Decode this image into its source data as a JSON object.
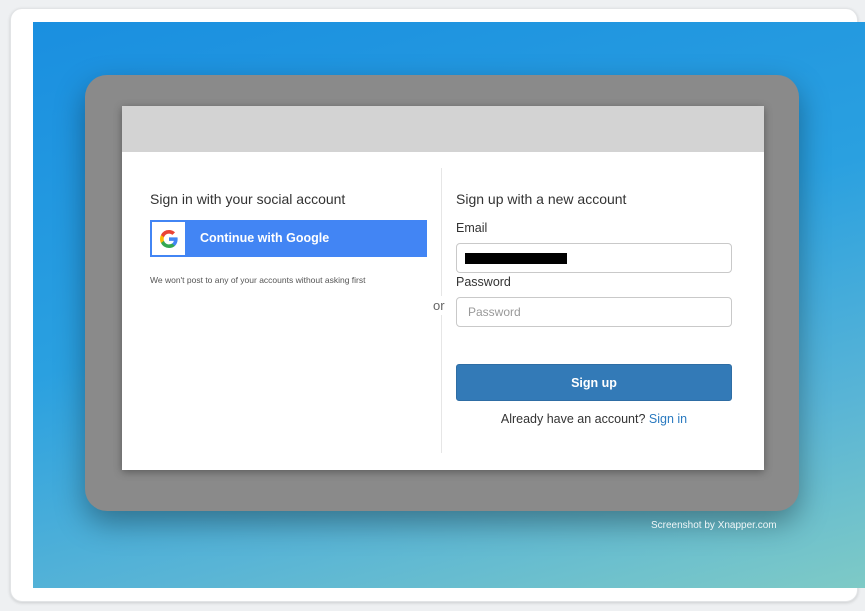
{
  "social": {
    "heading": "Sign in with your social account",
    "google_button_label": "Continue with Google",
    "google_icon_letter": "G",
    "note": "We won't post to any of your accounts without asking first"
  },
  "separator": {
    "label": "or"
  },
  "signup": {
    "heading": "Sign up with a new account",
    "email_label": "Email",
    "email_value": "",
    "password_label": "Password",
    "password_placeholder": "Password",
    "submit_label": "Sign up",
    "already_text": "Already have an account?",
    "signin_link": "Sign in"
  },
  "watermark": "Screenshot by Xnapper.com",
  "colors": {
    "google_blue": "#4285f4",
    "signup_button": "#337ab7",
    "link": "#2a7ac0",
    "header_gray": "#d3d3d3"
  }
}
